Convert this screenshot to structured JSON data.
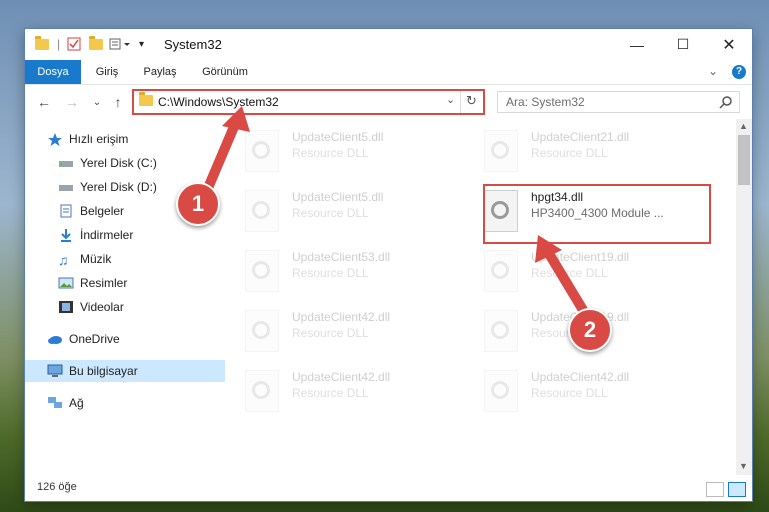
{
  "window": {
    "title": "System32"
  },
  "ribbon": {
    "tabs": [
      "Dosya",
      "Giriş",
      "Paylaş",
      "Görünüm"
    ]
  },
  "address": {
    "path": "C:\\Windows\\System32"
  },
  "search": {
    "placeholder": "Ara: System32"
  },
  "sidebar": {
    "items": [
      {
        "label": "Hızlı erişim"
      },
      {
        "label": "Yerel Disk (C:)"
      },
      {
        "label": "Yerel Disk (D:)"
      },
      {
        "label": "Belgeler"
      },
      {
        "label": "İndirmeler"
      },
      {
        "label": "Müzik"
      },
      {
        "label": "Resimler"
      },
      {
        "label": "Videolar"
      },
      {
        "label": "OneDrive"
      },
      {
        "label": "Bu bilgisayar"
      },
      {
        "label": "Ağ"
      }
    ]
  },
  "files": [
    {
      "name": "UpdateClient5.dll",
      "desc": "Resource DLL"
    },
    {
      "name": "UpdateClient21.dll",
      "desc": "Resource DLL"
    },
    {
      "name": "UpdateClient5.dll",
      "desc": "Resource DLL"
    },
    {
      "name": "hpgt34.dll",
      "desc": "HP3400_4300 Module ..."
    },
    {
      "name": "UpdateClient53.dll",
      "desc": "Resource DLL"
    },
    {
      "name": "UpdateClient19.dll",
      "desc": "Resource DLL"
    },
    {
      "name": "UpdateClient42.dll",
      "desc": "Resource DLL"
    },
    {
      "name": "UpdateClient19.dll",
      "desc": "Resource DLL"
    },
    {
      "name": "UpdateClient42.dll",
      "desc": "Resource DLL"
    },
    {
      "name": "UpdateClient42.dll",
      "desc": "Resource DLL"
    }
  ],
  "status": {
    "count": "126 öğe"
  },
  "annotations": {
    "step1": "1",
    "step2": "2"
  },
  "colors": {
    "accent": "#1979ca",
    "highlight": "#d94a45",
    "selection": "#cce8ff"
  }
}
